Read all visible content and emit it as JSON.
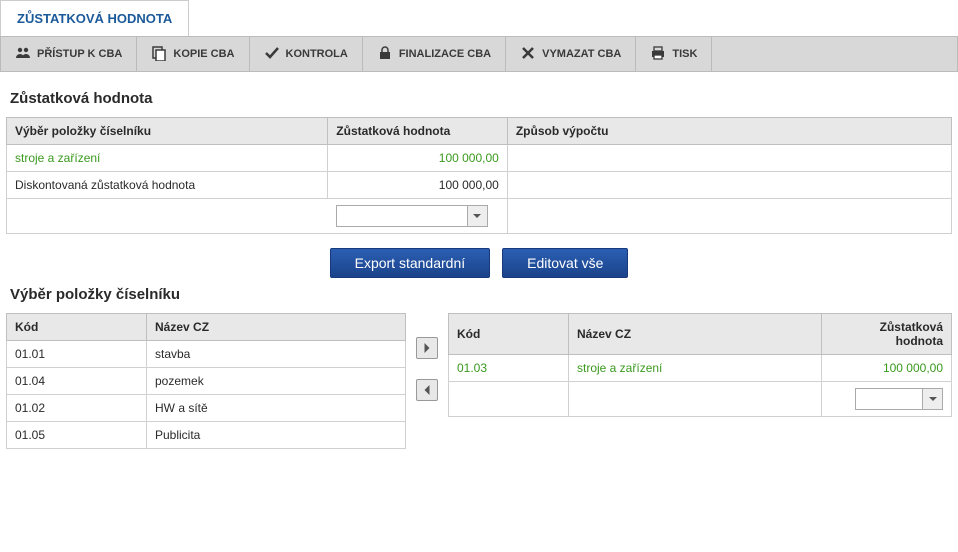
{
  "mainTab": "ZŮSTATKOVÁ HODNOTA",
  "toolbar": [
    {
      "icon": "people-icon",
      "label": "PŘÍSTUP K CBA"
    },
    {
      "icon": "copy-icon",
      "label": "KOPIE CBA"
    },
    {
      "icon": "check-icon",
      "label": "KONTROLA"
    },
    {
      "icon": "lock-icon",
      "label": "FINALIZACE CBA"
    },
    {
      "icon": "cancel-icon",
      "label": "VYMAZAT CBA"
    },
    {
      "icon": "print-icon",
      "label": "TISK"
    }
  ],
  "section1": {
    "title": "Zůstatková hodnota",
    "headers": {
      "col1": "Výběr položky číselníku",
      "col2": "Zůstatková hodnota",
      "col3": "Způsob výpočtu"
    },
    "rows": [
      {
        "label": "stroje a zařízení",
        "value": "100 000,00",
        "calc": "",
        "link": true
      },
      {
        "label": "Diskontovaná zůstatková hodnota",
        "value": "100 000,00",
        "calc": "",
        "link": false
      }
    ]
  },
  "buttons": {
    "export": "Export standardní",
    "editAll": "Editovat vše"
  },
  "section2": {
    "title": "Výběr položky číselníku",
    "leftHeaders": {
      "code": "Kód",
      "name": "Název CZ"
    },
    "leftRows": [
      {
        "code": "01.01",
        "name": "stavba"
      },
      {
        "code": "01.04",
        "name": "pozemek"
      },
      {
        "code": "01.02",
        "name": "HW a sítě"
      },
      {
        "code": "01.05",
        "name": "Publicita"
      }
    ],
    "rightHeaders": {
      "code": "Kód",
      "name": "Název CZ",
      "value": "Zůstatková hodnota"
    },
    "rightRows": [
      {
        "code": "01.03",
        "name": "stroje a zařízení",
        "value": "100 000,00"
      }
    ]
  }
}
